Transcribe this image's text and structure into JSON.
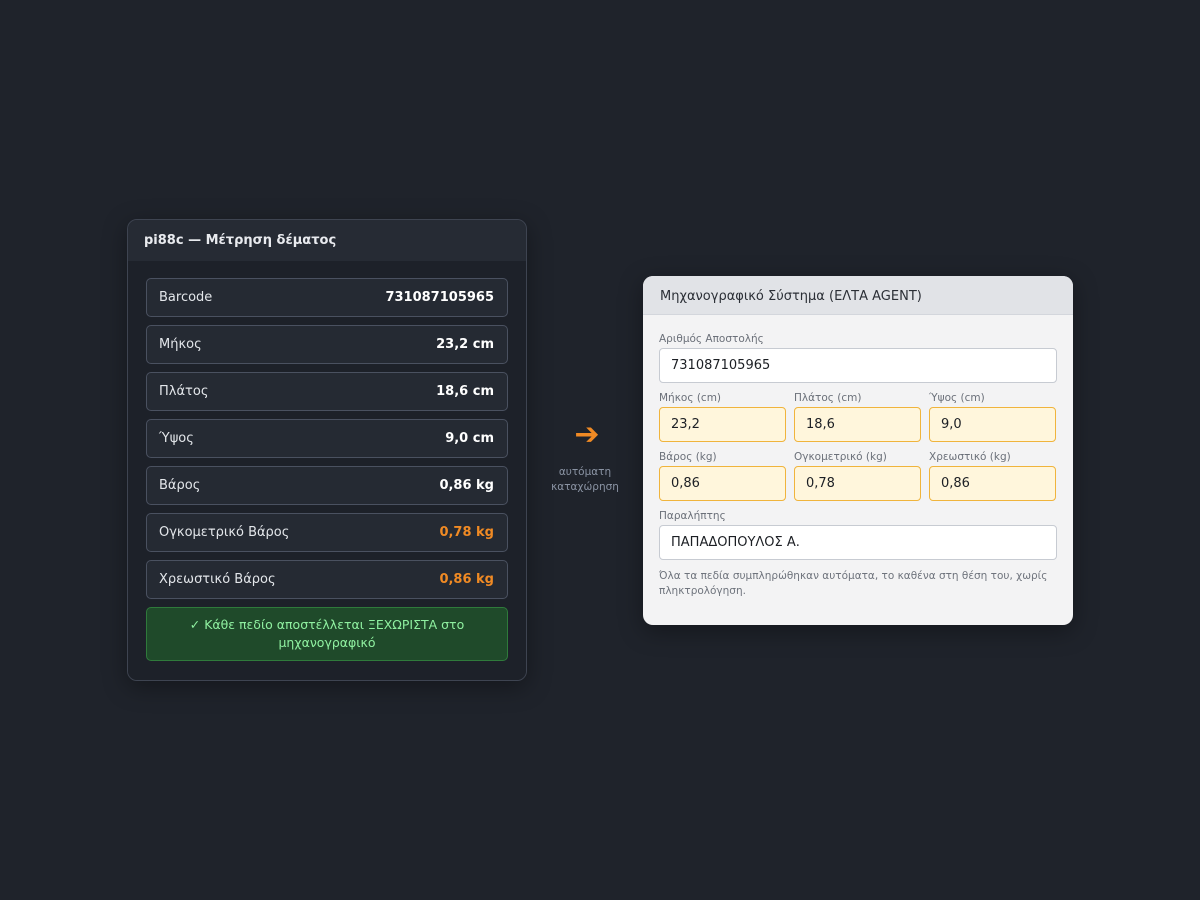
{
  "left_panel": {
    "title": "pi88c — Μέτρηση δέματος",
    "rows": [
      {
        "label": "Barcode",
        "value": "731087105965"
      },
      {
        "label": "Μήκος",
        "value": "23,2 cm"
      },
      {
        "label": "Πλάτος",
        "value": "18,6 cm"
      },
      {
        "label": "Ύψος",
        "value": "9,0 cm"
      },
      {
        "label": "Βάρος",
        "value": "0,86 kg"
      },
      {
        "label": "Ογκομετρικό Βάρος",
        "value": "0,78 kg"
      },
      {
        "label": "Χρεωστικό Βάρος",
        "value": "0,86 kg"
      }
    ],
    "success_note": "✓ Κάθε πεδίο αποστέλλεται ΞΕΧΩΡΙΣΤΑ στο μηχανογραφικό"
  },
  "arrow": {
    "icon": "right-arrow-icon",
    "caption_line1": "αυτόματη",
    "caption_line2": "καταχώρηση"
  },
  "right_panel": {
    "title": "Μηχανογραφικό Σύστημα (ΕΛΤΑ AGENT)",
    "shipment_number": {
      "label": "Αριθμός Αποστολής",
      "value": "731087105965"
    },
    "length": {
      "label": "Μήκος (cm)",
      "value": "23,2"
    },
    "width": {
      "label": "Πλάτος (cm)",
      "value": "18,6"
    },
    "height": {
      "label": "Ύψος (cm)",
      "value": "9,0"
    },
    "weight": {
      "label": "Βάρος (kg)",
      "value": "0,86"
    },
    "volumetric": {
      "label": "Ογκομετρικό (kg)",
      "value": "0,78"
    },
    "chargeable": {
      "label": "Χρεωστικό (kg)",
      "value": "0,86"
    },
    "recipient": {
      "label": "Παραλήπτης",
      "value": "ΠΑΠΑΔΟΠΟΥΛΟΣ Α."
    },
    "footer_note": "Όλα τα πεδία συμπληρώθηκαν αυτόματα, το καθένα στη θέση του, χωρίς πληκτρολόγηση."
  },
  "colors": {
    "accent": "#f08a24",
    "success_bg": "#1f4a2a",
    "success_text": "#8ff0a0",
    "autofill_bg": "#fff6dc",
    "autofill_border": "#f0b43c"
  }
}
